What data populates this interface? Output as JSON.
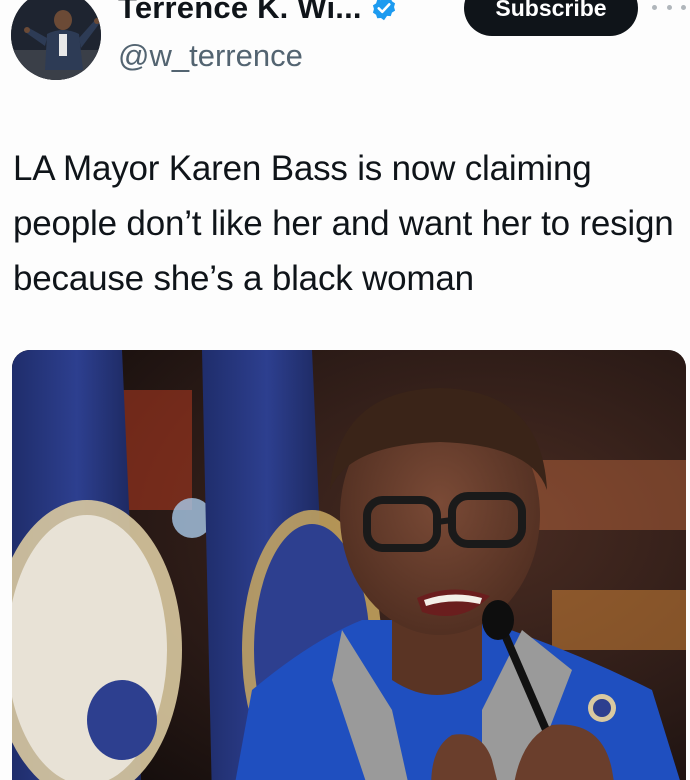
{
  "author": {
    "display_name": "Terrence K. Wi...",
    "handle": "@w_terrence",
    "verified": true,
    "avatar_icon": "profile-photo"
  },
  "actions": {
    "subscribe_label": "Subscribe",
    "more_icon": "more-horizontal-icon"
  },
  "tweet": {
    "text": "LA Mayor Karen Bass is now claiming people don’t like her and want her to resign because she’s a black woman"
  },
  "colors": {
    "text_primary": "#0f1419",
    "text_secondary": "#536471",
    "verified_blue": "#1d9bf0",
    "button_dark": "#0f1419"
  }
}
